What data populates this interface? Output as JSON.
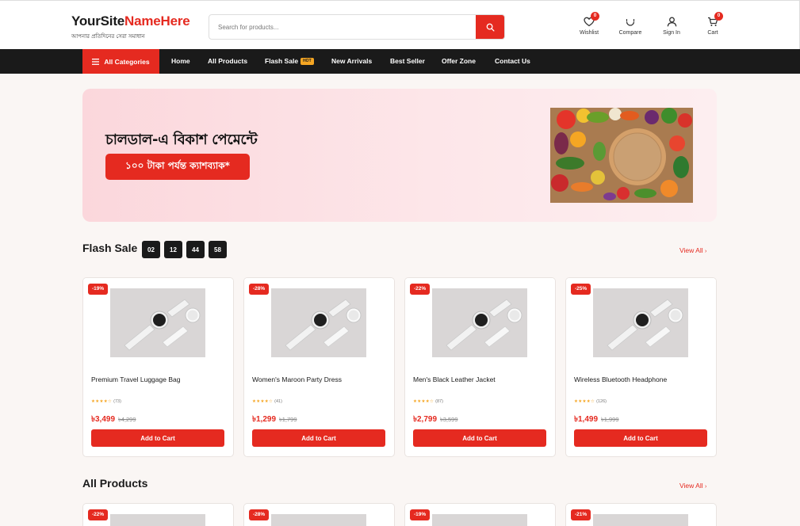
{
  "header": {
    "logo_dark": "YourSite",
    "logo_red": "NameHere",
    "tagline": "আপনার প্রতিদিনের সেরা সমাধান",
    "search_placeholder": "Search for products...",
    "icons": [
      {
        "name": "heart-icon",
        "label": "Wishlist",
        "badge": "0"
      },
      {
        "name": "refresh-icon",
        "label": "Compare",
        "badge": ""
      },
      {
        "name": "user-icon",
        "label": "Sign In",
        "badge": ""
      },
      {
        "name": "cart-icon",
        "label": "Cart",
        "badge": "0"
      }
    ]
  },
  "nav": {
    "categories": "All Categories",
    "items": [
      "Home",
      "All Products",
      "Flash Sale",
      "New Arrivals",
      "Best Seller",
      "Offer Zone",
      "Contact Us"
    ],
    "hot_badge": "HOT"
  },
  "hero": {
    "title": "চালডাল-এ বিকাশ পেমেন্টে",
    "button": "১০০ টাকা পর্যন্ত ক্যাশব্যাক*"
  },
  "flash": {
    "title": "Flash Sale",
    "timer": [
      "02",
      "12",
      "44",
      "58"
    ],
    "view_all": "View All"
  },
  "products": [
    {
      "discount": "-19%",
      "name": "Premium Travel Luggage Bag",
      "stars": "★★★★☆",
      "reviews": "(73)",
      "price": "৳3,499",
      "old": "৳4,299",
      "cta": "Add to Cart"
    },
    {
      "discount": "-28%",
      "name": "Women's Maroon Party Dress",
      "stars": "★★★★☆",
      "reviews": "(41)",
      "price": "৳1,299",
      "old": "৳1,799",
      "cta": "Add to Cart"
    },
    {
      "discount": "-22%",
      "name": "Men's Black Leather Jacket",
      "stars": "★★★★☆",
      "reviews": "(87)",
      "price": "৳2,799",
      "old": "৳3,599",
      "cta": "Add to Cart"
    },
    {
      "discount": "-25%",
      "name": "Wireless Bluetooth Headphone",
      "stars": "★★★★☆",
      "reviews": "(126)",
      "price": "৳1,499",
      "old": "৳1,999",
      "cta": "Add to Cart"
    }
  ],
  "all_products": {
    "title": "All Products",
    "view_all": "View All",
    "discounts": [
      "-22%",
      "-28%",
      "-19%",
      "-21%"
    ]
  },
  "colors": {
    "accent": "#e52a20",
    "dark": "#1a1a1a",
    "hot": "#f5a623"
  }
}
